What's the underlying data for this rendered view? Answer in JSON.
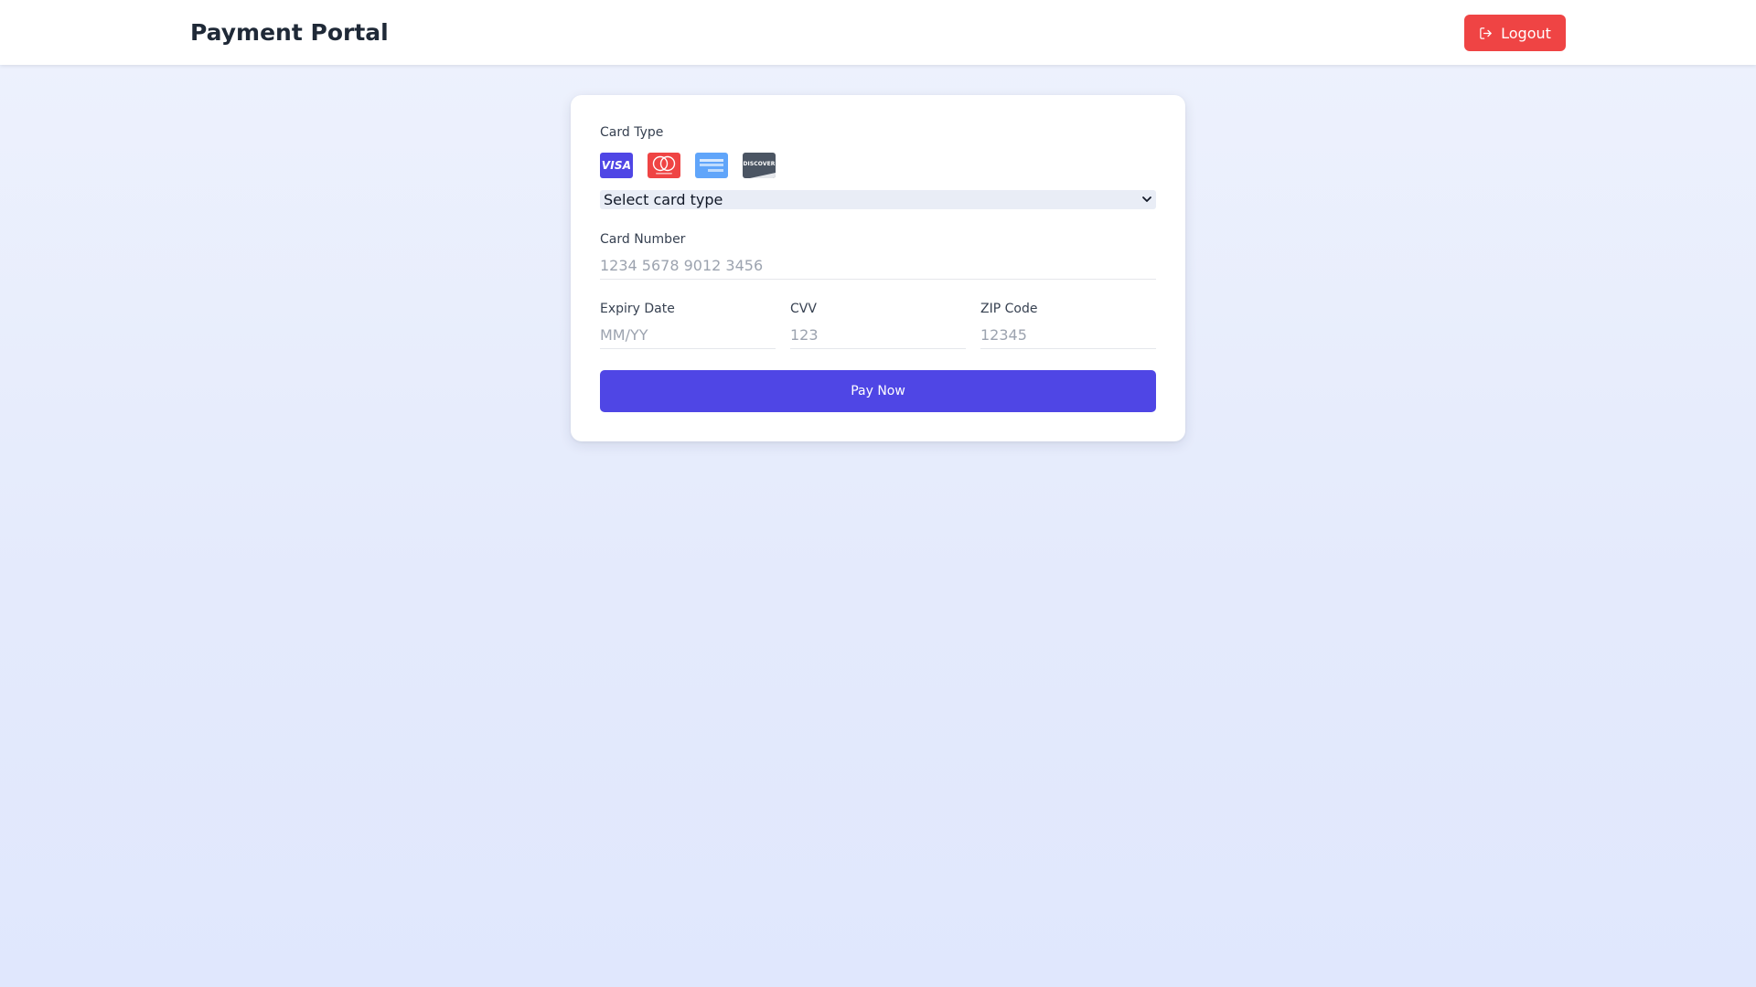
{
  "header": {
    "title": "Payment Portal",
    "logout_label": "Logout",
    "logout_icon": "logout-icon"
  },
  "form": {
    "card_type_label": "Card Type",
    "card_brands": [
      {
        "name": "VISA",
        "color": "#4f46e5"
      },
      {
        "name": "Mastercard",
        "color": "#ef4444"
      },
      {
        "name": "American Express",
        "color": "#60a5fa"
      },
      {
        "name": "DISCOVER",
        "color": "#4b5563"
      }
    ],
    "card_type_select": {
      "selected": "Select card type"
    },
    "card_number": {
      "label": "Card Number",
      "placeholder": "1234 5678 9012 3456"
    },
    "expiry": {
      "label": "Expiry Date",
      "placeholder": "MM/YY"
    },
    "cvv": {
      "label": "CVV",
      "placeholder": "123"
    },
    "zip": {
      "label": "ZIP Code",
      "placeholder": "12345"
    },
    "submit_label": "Pay Now"
  },
  "colors": {
    "accent": "#4f46e5",
    "danger": "#ef4444",
    "page_bg": "#e6ecfc"
  }
}
